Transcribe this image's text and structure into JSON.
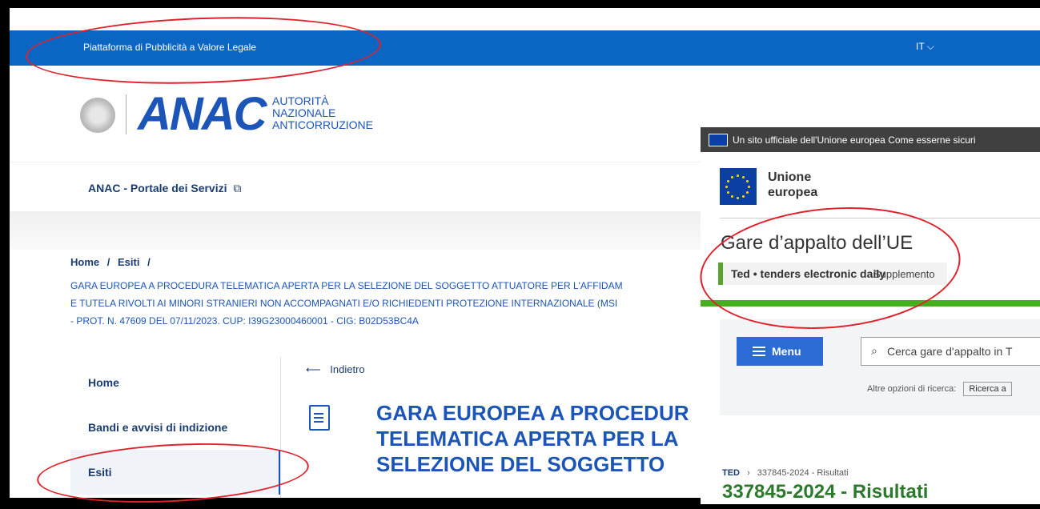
{
  "anac": {
    "topbar_title": "Piattaforma di Pubblicità a Valore Legale",
    "language": "IT ⌵",
    "logo_sub_1": "AUTORITÀ",
    "logo_sub_2": "NAZIONALE",
    "logo_sub_3": "ANTICORRUZIONE",
    "logo_word": "ANAC",
    "portal_link": "ANAC - Portale dei Servizi",
    "external_glyph": "⧉",
    "breadcrumb": [
      "Home",
      "/",
      "Esiti",
      "/"
    ],
    "description_lines": [
      "GARA EUROPEA A PROCEDURA TELEMATICA APERTA PER LA SELEZIONE DEL SOGGETTO ATTUATORE PER L'AFFIDAM",
      "E TUTELA RIVOLTI AI MINORI STRANIERI NON ACCOMPAGNATI E/O RICHIEDENTI PROTEZIONE INTERNAZIONALE (MSI",
      "- PROT. N. 47609 DEL 07/11/2023. CUP: I39G23000460001 - CIG: B02D53BC4A"
    ],
    "sidebar": [
      "Home",
      "Bandi e avvisi di indizione",
      "Esiti"
    ],
    "back_label": "Indietro",
    "back_arrow": "⟵",
    "title_lines": [
      "GARA EUROPEA A PROCEDUR",
      "TELEMATICA APERTA PER LA",
      "SELEZIONE DEL SOGGETTO"
    ]
  },
  "ted": {
    "eu_bar_text": "Un sito ufficiale dell'Unione europea   Come esserne sicuri",
    "brand_line_1": "Unione",
    "brand_line_2": "europea",
    "heading": "Gare d’appalto dell’UE",
    "tag_main": "Ted • tenders electronic daily",
    "tag_sub": "Supplemento",
    "menu_label": "Menu",
    "search_glyph": "⌕",
    "search_placeholder": "Cerca gare d'appalto in T",
    "more_options_label": "Altre opzioni di ricerca:",
    "more_options_button": "Ricerca a",
    "breadcrumb_root": "TED",
    "breadcrumb_sep": "›",
    "breadcrumb_current": "337845-2024 - Risultati",
    "result_title": "337845-2024 - Risultati"
  },
  "colors": {
    "anac_blue": "#0a66c2",
    "annotation_red": "#e0212b",
    "ted_green": "#45b01f",
    "eu_blue": "#0c3fa3"
  }
}
